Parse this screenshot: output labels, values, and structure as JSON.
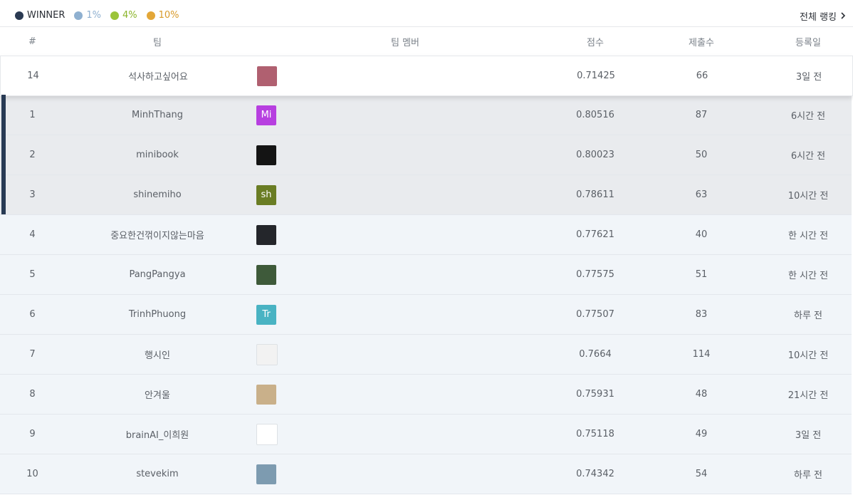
{
  "legend": [
    {
      "label": "WINNER",
      "color": "#2b3a52",
      "text_color": "#2b2f36"
    },
    {
      "label": "1%",
      "color": "#8fb0d0",
      "text_color": "#8fb0d0"
    },
    {
      "label": "4%",
      "color": "#9bc43a",
      "text_color": "#8bb42a"
    },
    {
      "label": "10%",
      "color": "#e3a738",
      "text_color": "#d89a2a"
    }
  ],
  "all_ranking": {
    "label": "전체 랭킹",
    "icon": "chevron-right-icon"
  },
  "columns": {
    "rank": "#",
    "team": "팀",
    "members": "팀 멤버",
    "score": "점수",
    "submissions": "제출수",
    "date": "등록일"
  },
  "rows": [
    {
      "rank": "14",
      "team": "석사하고싶어요",
      "avatar_text": "",
      "avatar_color": "#b06070",
      "score": "0.71425",
      "submissions": "66",
      "date": "3일 전",
      "style": "mine"
    },
    {
      "rank": "1",
      "team": "MinhThang",
      "avatar_text": "Mi",
      "avatar_color": "#b73fe0",
      "score": "0.80516",
      "submissions": "87",
      "date": "6시간 전",
      "style": "winner"
    },
    {
      "rank": "2",
      "team": "minibook",
      "avatar_text": "",
      "avatar_color": "#141414",
      "score": "0.80023",
      "submissions": "50",
      "date": "6시간 전",
      "style": "winner"
    },
    {
      "rank": "3",
      "team": "shinemiho",
      "avatar_text": "sh",
      "avatar_color": "#6a7d24",
      "score": "0.78611",
      "submissions": "63",
      "date": "10시간 전",
      "style": "winner"
    },
    {
      "rank": "4",
      "team": "중요한건꺾이지않는마음",
      "avatar_text": "",
      "avatar_color": "#24262b",
      "score": "0.77621",
      "submissions": "40",
      "date": "한 시간 전",
      "style": "normal"
    },
    {
      "rank": "5",
      "team": "PangPangya",
      "avatar_text": "",
      "avatar_color": "#3e5a3a",
      "score": "0.77575",
      "submissions": "51",
      "date": "한 시간 전",
      "style": "normal"
    },
    {
      "rank": "6",
      "team": "TrinhPhuong",
      "avatar_text": "Tr",
      "avatar_color": "#49b3c3",
      "score": "0.77507",
      "submissions": "83",
      "date": "하루 전",
      "style": "normal"
    },
    {
      "rank": "7",
      "team": "행시인",
      "avatar_text": "",
      "avatar_color": "#f2f2f2",
      "score": "0.7664",
      "submissions": "114",
      "date": "10시간 전",
      "style": "normal"
    },
    {
      "rank": "8",
      "team": "안겨울",
      "avatar_text": "",
      "avatar_color": "#c9b08a",
      "score": "0.75931",
      "submissions": "48",
      "date": "21시간 전",
      "style": "normal"
    },
    {
      "rank": "9",
      "team": "brainAI_이희원",
      "avatar_text": "",
      "avatar_color": "#ffffff",
      "score": "0.75118",
      "submissions": "49",
      "date": "3일 전",
      "style": "normal"
    },
    {
      "rank": "10",
      "team": "stevekim",
      "avatar_text": "",
      "avatar_color": "#7d9bb0",
      "score": "0.74342",
      "submissions": "54",
      "date": "하루 전",
      "style": "normal"
    }
  ]
}
